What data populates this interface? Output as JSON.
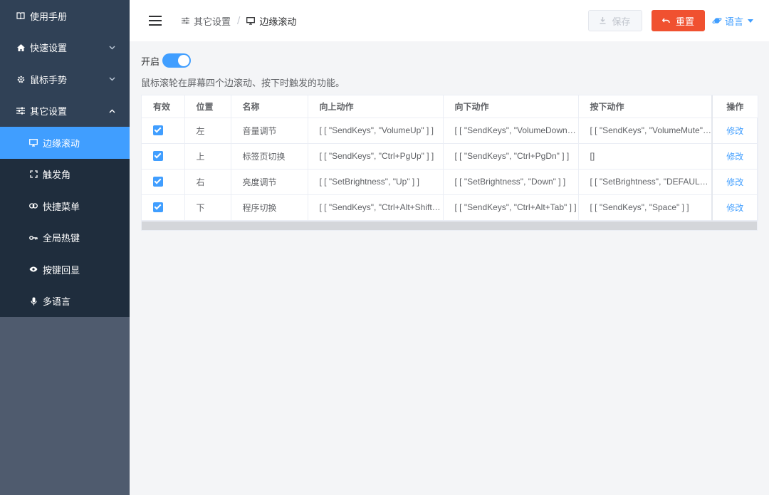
{
  "sidebar": {
    "items": [
      {
        "label": "使用手册"
      },
      {
        "label": "快速设置"
      },
      {
        "label": "鼠标手势"
      },
      {
        "label": "其它设置"
      }
    ],
    "sub_items": [
      {
        "label": "边缘滚动"
      },
      {
        "label": "触发角"
      },
      {
        "label": "快捷菜单"
      },
      {
        "label": "全局热键"
      },
      {
        "label": "按键回显"
      },
      {
        "label": "多语言"
      }
    ]
  },
  "header": {
    "breadcrumb": [
      "其它设置",
      "边缘滚动"
    ],
    "save_label": "保存",
    "reset_label": "重置",
    "lang_label": "语言"
  },
  "main": {
    "toggle_label": "开启",
    "toggle_on": true,
    "description": "鼠标滚轮在屏幕四个边滚动、按下时触发的功能。"
  },
  "table": {
    "headers": [
      "有效",
      "位置",
      "名称",
      "向上动作",
      "向下动作",
      "按下动作",
      "操作"
    ],
    "rows": [
      {
        "pos": "左",
        "name": "音量调节",
        "up": "[ [ \"SendKeys\", \"VolumeUp\" ] ]",
        "down": "[ [ \"SendKeys\", \"VolumeDown…",
        "press": "[ [ \"SendKeys\", \"VolumeMute\" ] ]",
        "op": "修改"
      },
      {
        "pos": "上",
        "name": "标签页切换",
        "up": "[ [ \"SendKeys\", \"Ctrl+PgUp\" ] ]",
        "down": "[ [ \"SendKeys\", \"Ctrl+PgDn\" ] ]",
        "press": "[]",
        "op": "修改"
      },
      {
        "pos": "右",
        "name": "亮度调节",
        "up": "[ [ \"SetBrightness\", \"Up\" ] ]",
        "down": "[ [ \"SetBrightness\", \"Down\" ] ]",
        "press": "[ [ \"SetBrightness\", \"DEFAUL…",
        "op": "修改"
      },
      {
        "pos": "下",
        "name": "程序切换",
        "up": "[ [ \"SendKeys\", \"Ctrl+Alt+Shift…",
        "down": "[ [ \"SendKeys\", \"Ctrl+Alt+Tab\" ] ]",
        "press": "[ [ \"SendKeys\", \"Space\" ] ]",
        "op": "修改"
      }
    ]
  },
  "colors": {
    "accent": "#409eff",
    "sidebar_bg": "#304156",
    "submenu_bg": "#1f2d3d",
    "danger": "#f05130"
  }
}
